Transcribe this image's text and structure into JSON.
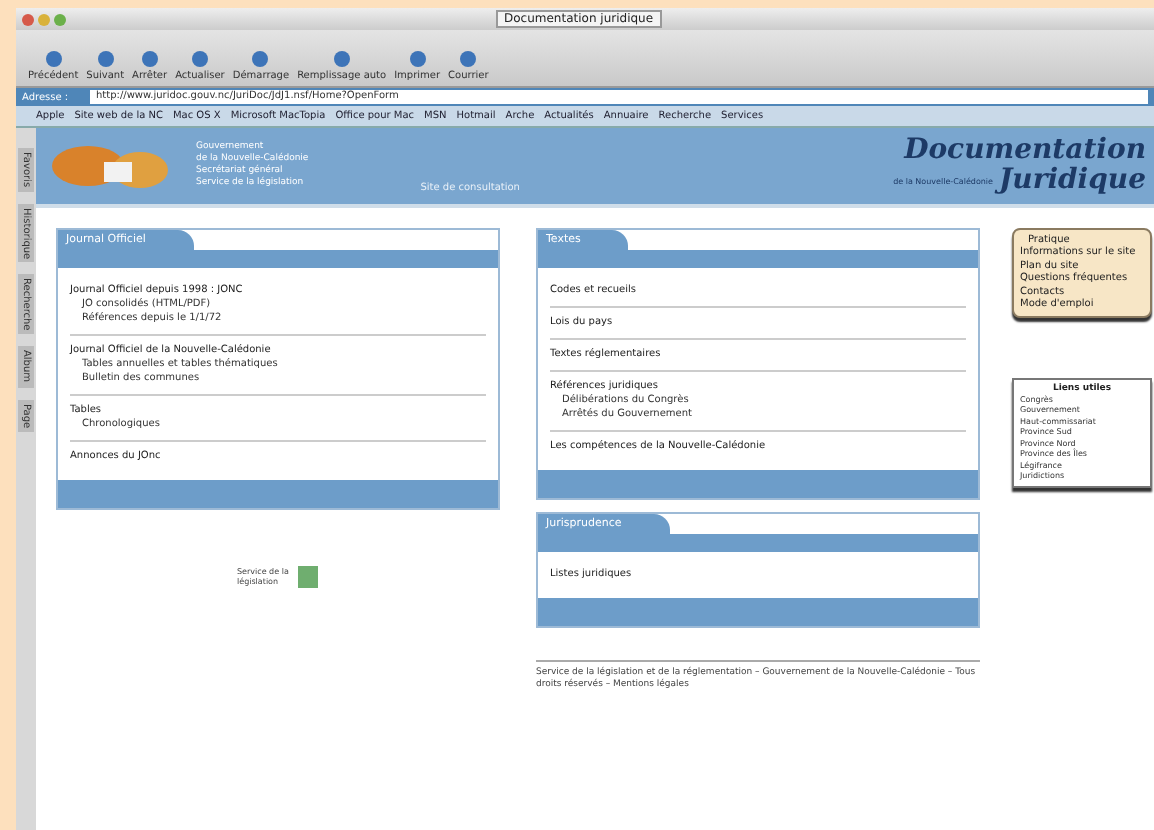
{
  "window": {
    "title": "Documentation juridique"
  },
  "toolbar": [
    "Précédent",
    "Suivant",
    "Arrêter",
    "Actualiser",
    "Démarrage",
    "Remplissage auto",
    "Imprimer",
    "Courrier"
  ],
  "address": {
    "label": "Adresse :",
    "value": "http://www.juridoc.gouv.nc/JuriDoc/JdJ1.nsf/Home?OpenForm"
  },
  "bookmarks": [
    "Apple",
    "Site web de la NC",
    "Mac OS X",
    "Microsoft MacTopia",
    "Office pour Mac",
    "MSN",
    "Hotmail",
    "Arche",
    "Actualités",
    "Annuaire",
    "Recherche",
    "Services"
  ],
  "side_tabs": [
    "Favoris",
    "Historique",
    "Recherche",
    "Album",
    "Page"
  ],
  "header": {
    "lines": [
      "Gouvernement",
      "de la Nouvelle-Calédonie",
      "Secrétariat général",
      "Service de la législation"
    ],
    "note": "Site de consultation",
    "title": "Documentation",
    "subtitle": "Juridique",
    "tagline": "de la Nouvelle-Calédonie"
  },
  "panels": [
    {
      "title": "Journal Officiel",
      "groups": [
        [
          "Journal Officiel depuis 1998 : JONC",
          "JO consolidés (HTML/PDF)",
          "Références depuis le 1/1/72"
        ],
        [
          "Journal Officiel de la Nouvelle-Calédonie",
          "Tables annuelles et tables thématiques",
          "Bulletin des communes"
        ],
        [
          "Tables",
          "Chronologiques"
        ],
        [
          "Annonces du JOnc"
        ]
      ]
    },
    {
      "title": "Textes",
      "groups": [
        [
          "Codes et recueils"
        ],
        [
          "Lois du pays"
        ],
        [
          "Textes réglementaires"
        ],
        [
          "Références juridiques",
          "Délibérations du Congrès",
          "Arrêtés du Gouvernement"
        ],
        [
          "Les compétences de la Nouvelle-Calédonie"
        ]
      ]
    },
    {
      "title": "Jurisprudence",
      "groups": [
        [
          "Listes juridiques"
        ]
      ]
    }
  ],
  "partner": {
    "text": "Service de la législation"
  },
  "footer": "Service de la législation et de la réglementation – Gouvernement de la Nouvelle-Calédonie – Tous droits réservés – Mentions légales",
  "info_box": {
    "title": "Pratique",
    "items": [
      "Informations sur le site",
      "Plan du site",
      "Questions fréquentes",
      "Contacts",
      "Mode d'emploi"
    ]
  },
  "links_box": {
    "title": "Liens utiles",
    "items": [
      "Congrès",
      "Gouvernement",
      "Haut-commissariat",
      "Province Sud",
      "Province Nord",
      "Province des Îles",
      "Légifrance",
      "Juridictions"
    ]
  }
}
